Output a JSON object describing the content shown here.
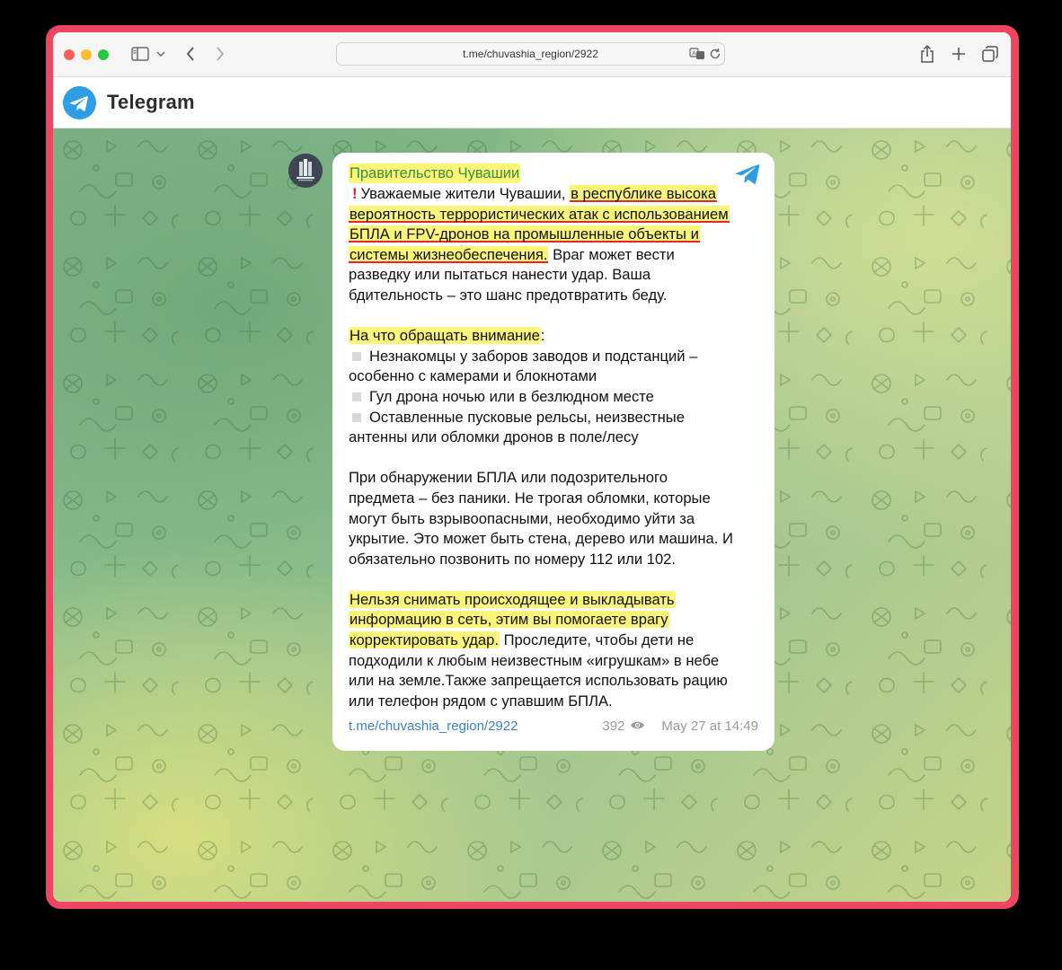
{
  "browser": {
    "url": "t.me/chuvashia_region/2922"
  },
  "app": {
    "title": "Telegram"
  },
  "colors": {
    "frame": "#ee4561",
    "telegram_blue": "#2f9de2",
    "channel_green": "#3e8e3d",
    "highlight": "#fbf57a",
    "underline": "#e8242c"
  },
  "message": {
    "channel": "Правительство Чувашии",
    "intro_plain": "Уважаемые жители Чувашии,",
    "intro_lines": [
      "в республике высока",
      "вероятность террористических атак с использованием",
      "БПЛА и FPV-дронов на промышленные объекты и",
      "системы жизнеобеспечения."
    ],
    "intro_rest": "Враг может вести",
    "intro_line5": "разведку или пытаться нанести удар. Ваша",
    "intro_line6": "бдительность – это шанс предотвратить беду.",
    "attention_title": "На что обращать внимание",
    "attention_colon": ":",
    "bullets": [
      {
        "line1": "Незнакомцы у заборов заводов и подстанций –",
        "line2": "особенно с камерами и блокнотами"
      },
      {
        "line1": "Гул дрона ночью или в безлюдном месте",
        "line2": ""
      },
      {
        "line1": "Оставленные пусковые рельсы, неизвестные",
        "line2": "антенны или обломки дронов в поле/лесу"
      }
    ],
    "para2": [
      "При обнаружении БПЛА или подозрительного",
      "предмета – без паники. Не трогая обломки, которые",
      "могут быть взрывоопасными, необходимо уйти за",
      "укрытие. Это может быть стена, дерево или машина. И",
      "обязательно позвонить по номеру 112 или 102."
    ],
    "warn_lines": [
      "Нельзя снимать происходящее и выкладывать",
      "информацию в сеть, этим вы помогаете врагу",
      "корректировать удар."
    ],
    "warn_rest": "Проследите, чтобы дети не",
    "para3": [
      "подходили к любым неизвестным «игрушкам» в небе",
      "или на земле.Также запрещается использовать рацию",
      "или телефон рядом с упавшим БПЛА."
    ],
    "link": "t.me/chuvashia_region/2922",
    "views": "392",
    "date": "May 27 at 14:49"
  }
}
